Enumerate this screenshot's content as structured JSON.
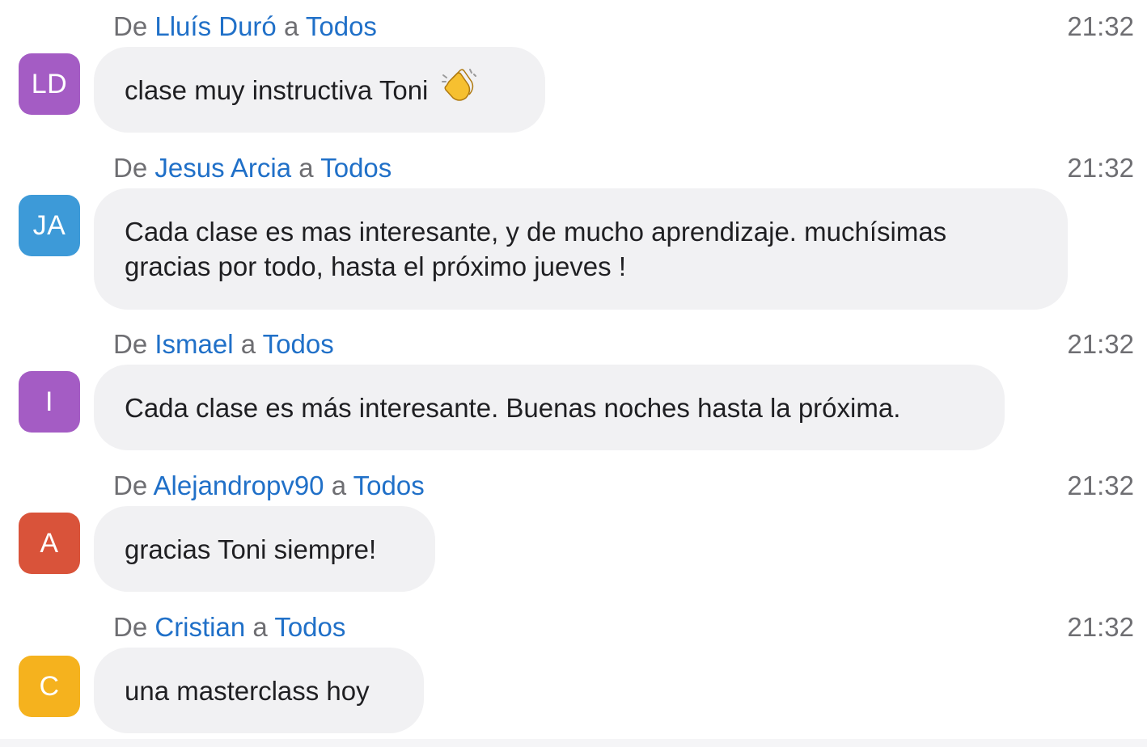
{
  "labels": {
    "from": "De",
    "to_word": "a"
  },
  "messages": [
    {
      "sender": "Lluís Duró",
      "recipient": "Todos",
      "time": "21:32",
      "initials": "LD",
      "avatar_color": "#a45cc4",
      "text": "clase muy instructiva Toni",
      "emoji": "clapping-hands"
    },
    {
      "sender": "Jesus Arcia",
      "recipient": "Todos",
      "time": "21:32",
      "initials": "JA",
      "avatar_color": "#3d9ad8",
      "text_line1": "Cada clase es mas interesante, y de mucho aprendizaje. muchísimas",
      "text_line2": "gracias por todo, hasta el próximo jueves !"
    },
    {
      "sender": "Ismael",
      "recipient": "Todos",
      "time": "21:32",
      "initials": "I",
      "avatar_color": "#a45cc4",
      "text": "Cada clase es más interesante. Buenas noches hasta la próxima."
    },
    {
      "sender": "Alejandropv90",
      "recipient": "Todos",
      "time": "21:32",
      "initials": "A",
      "avatar_color": "#d9533a",
      "text": "gracias Toni siempre!"
    },
    {
      "sender": "Cristian",
      "recipient": "Todos",
      "time": "21:32",
      "initials": "C",
      "avatar_color": "#f5b21e",
      "text": "una masterclass hoy"
    }
  ]
}
